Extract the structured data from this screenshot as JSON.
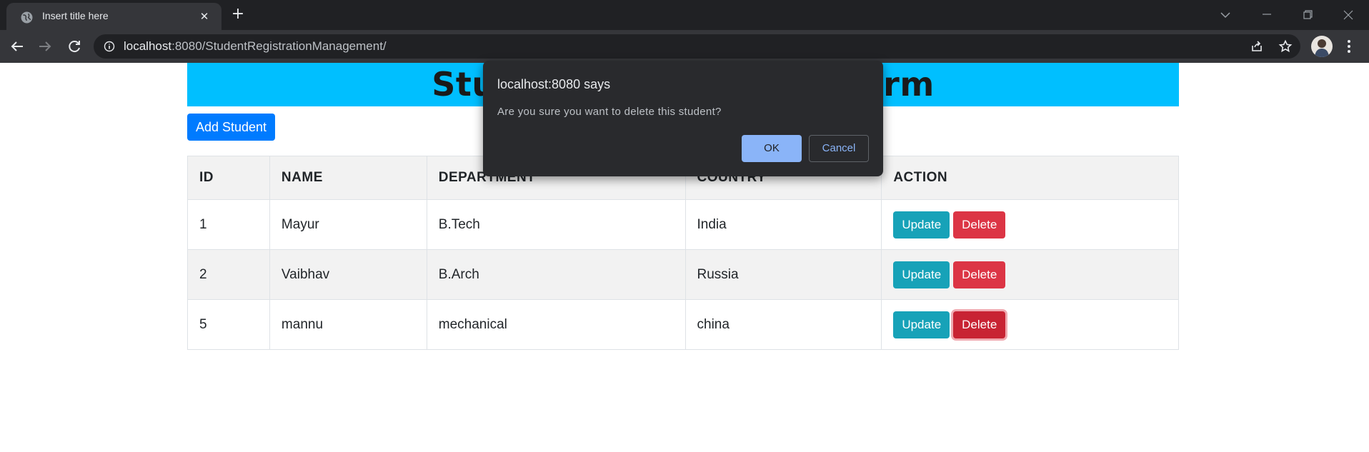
{
  "browser": {
    "tab_title": "Insert title here",
    "url_host": "localhost",
    "url_rest": ":8080/StudentRegistrationManagement/"
  },
  "page": {
    "banner_title": "Student Registration Form",
    "add_button": "Add Student",
    "table": {
      "headers": [
        "ID",
        "NAME",
        "DEPARTMENT",
        "COUNTRY",
        "ACTION"
      ],
      "rows": [
        {
          "id": "1",
          "name": "Mayur",
          "department": "B.Tech",
          "country": "India",
          "update": "Update",
          "delete": "Delete"
        },
        {
          "id": "2",
          "name": "Vaibhav",
          "department": "B.Arch",
          "country": "Russia",
          "update": "Update",
          "delete": "Delete"
        },
        {
          "id": "5",
          "name": "mannu",
          "department": "mechanical",
          "country": "china",
          "update": "Update",
          "delete": "Delete"
        }
      ]
    }
  },
  "dialog": {
    "title": "localhost:8080 says",
    "message": "Are you sure you want to delete this student?",
    "ok": "OK",
    "cancel": "Cancel"
  },
  "colors": {
    "banner": "#00bfff",
    "primary": "#007bff",
    "update": "#17a2b8",
    "delete": "#dc3545"
  }
}
